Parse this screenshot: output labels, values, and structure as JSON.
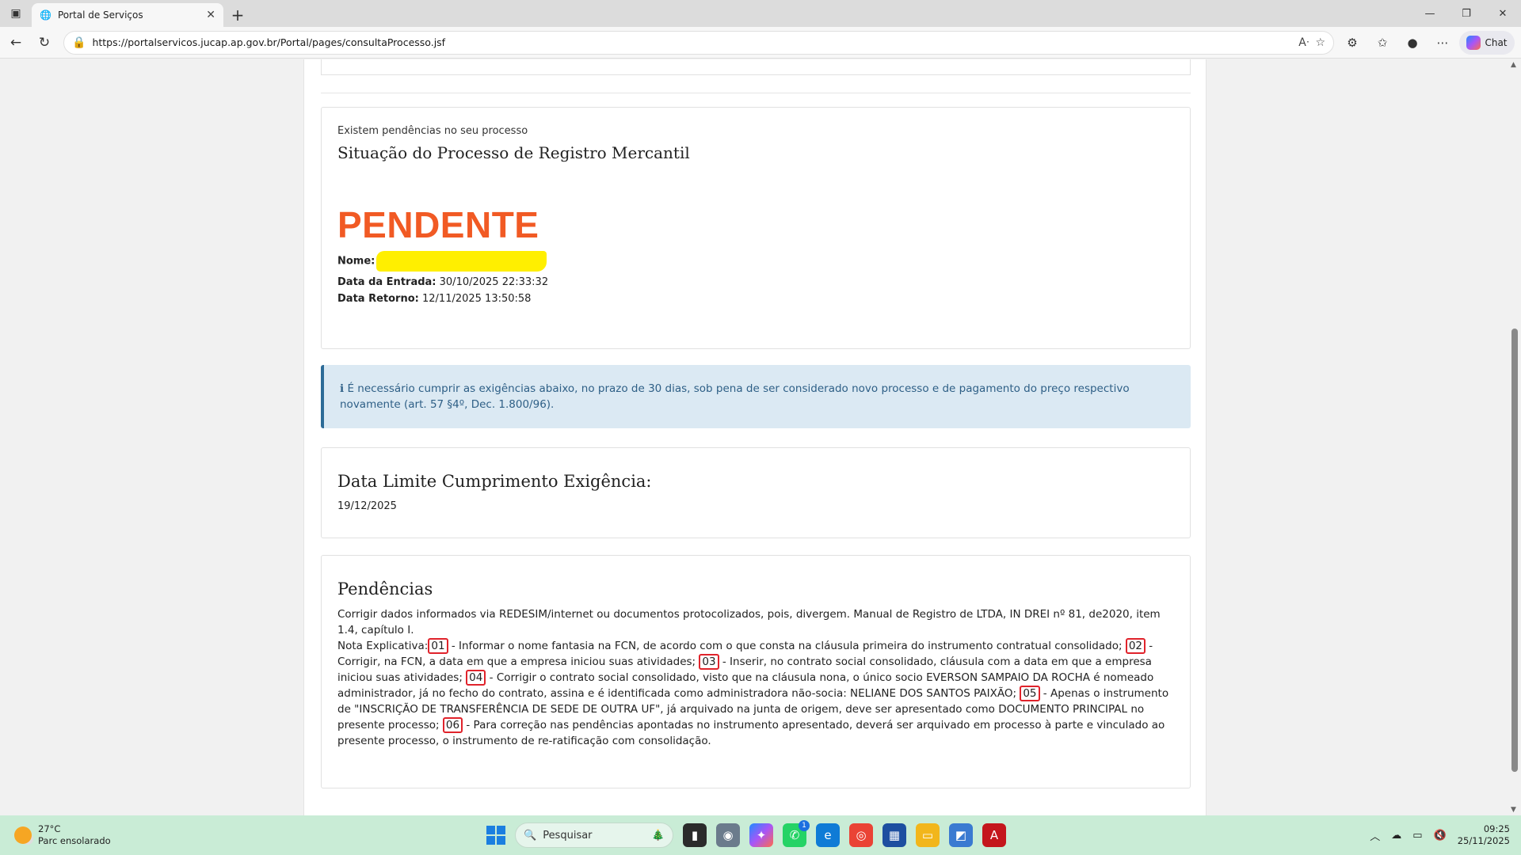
{
  "browser": {
    "tab_title": "Portal de Serviços",
    "url": "https://portalservicos.jucap.ap.gov.br/Portal/pages/consultaProcesso.jsf",
    "chat_label": "Chat"
  },
  "status_panel": {
    "note": "Existem pendências no seu processo",
    "title": "Situação do Processo de Registro Mercantil",
    "status": "PENDENTE",
    "nome_label": "Nome:",
    "entrada_label": "Data da Entrada:",
    "entrada_value": "30/10/2025 22:33:32",
    "retorno_label": "Data Retorno:",
    "retorno_value": "12/11/2025 13:50:58"
  },
  "alert": {
    "icon": "ℹ",
    "text": "É necessário cumprir as exigências abaixo, no prazo de 30 dias, sob pena de ser considerado novo processo e de pagamento do preço respectivo novamente (art. 57 §4º, Dec. 1.800/96)."
  },
  "limit_panel": {
    "title": "Data Limite Cumprimento Exigência:",
    "date": "19/12/2025"
  },
  "pendencias": {
    "title": "Pendências",
    "intro": "Corrigir dados informados via REDESIM/internet ou documentos protocolizados, pois, divergem. Manual de Registro de LTDA, IN DREI nº 81, de2020, item 1.4, capítulo I.",
    "nota_label": "Nota Explicativa:",
    "items": [
      {
        "num": "01",
        "text": " - Informar o nome fantasia na FCN, de acordo com o que consta na cláusula primeira do instrumento contratual consolidado; "
      },
      {
        "num": "02",
        "text": " - Corrigir, na FCN, a data em que a empresa iniciou suas atividades; "
      },
      {
        "num": "03",
        "text": " - Inserir, no contrato social consolidado, cláusula com a data em que a empresa iniciou suas atividades; "
      },
      {
        "num": "04",
        "text": " - Corrigir o contrato social consolidado, visto que na cláusula nona, o único socio EVERSON SAMPAIO DA ROCHA é nomeado administrador, já no fecho do contrato, assina e é identificada como administradora não-socia: NELIANE DOS SANTOS PAIXÃO; "
      },
      {
        "num": "05",
        "text": " - Apenas o instrumento de \"INSCRIÇÃO DE TRANSFERÊNCIA DE SEDE DE OUTRA UF\", já arquivado na junta de origem, deve ser apresentado como DOCUMENTO PRINCIPAL no presente processo; "
      },
      {
        "num": "06",
        "text": " - Para correção nas pendências apontadas no instrumento apresentado, deverá ser arquivado em processo à parte e vinculado ao presente processo, o instrumento de re-ratificação com consolidação."
      }
    ]
  },
  "taskbar": {
    "temp": "27°C",
    "weather": "Parc ensolarado",
    "search_placeholder": "Pesquisar",
    "whatsapp_badge": "1",
    "time": "09:25",
    "date": "25/11/2025"
  },
  "colors": {
    "status_orange": "#f15a24",
    "alert_bg": "#dbe9f3",
    "alert_border": "#2d6b97",
    "highlight_red": "#e0232b",
    "redaction_yellow": "#ffef00",
    "taskbar_bg": "#c9ecd6"
  }
}
